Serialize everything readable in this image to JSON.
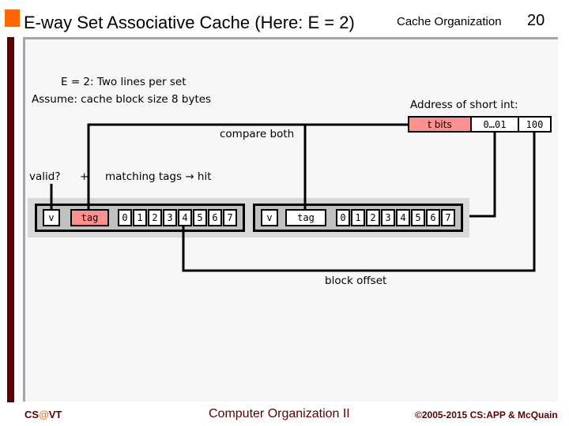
{
  "header": {
    "title": "E-way Set Associative Cache (Here: E = 2)",
    "section": "Cache Organization",
    "page_number": "20"
  },
  "diagram": {
    "note_line1": "E = 2: Two lines per set",
    "note_line2": "Assume: cache block size 8 bytes",
    "address_label": "Address of short int:",
    "address_fields": [
      {
        "label": "t bits",
        "highlight": true
      },
      {
        "label": "0…01",
        "highlight": false
      },
      {
        "label": "100",
        "highlight": false
      }
    ],
    "compare_label": "compare both",
    "valid_label": "valid?",
    "plus_label": "+",
    "match_label": "matching tags → hit",
    "lines": [
      {
        "valid": "v",
        "tag": "tag",
        "tag_highlight": true,
        "bytes": [
          "0",
          "1",
          "2",
          "3",
          "4",
          "5",
          "6",
          "7"
        ]
      },
      {
        "valid": "v",
        "tag": "tag",
        "tag_highlight": false,
        "bytes": [
          "0",
          "1",
          "2",
          "3",
          "4",
          "5",
          "6",
          "7"
        ]
      }
    ],
    "block_offset_label": "block offset"
  },
  "footer": {
    "left_prefix": "CS",
    "left_at": "@",
    "left_suffix": "VT",
    "center": "Computer Organization II",
    "right": "©2005-2015 CS:APP & McQuain"
  },
  "colors": {
    "accent_orange": "#ff6600",
    "maroon": "#5c0000",
    "tag_pink": "#ff9090",
    "panel_bg": "#f7f7f7"
  }
}
